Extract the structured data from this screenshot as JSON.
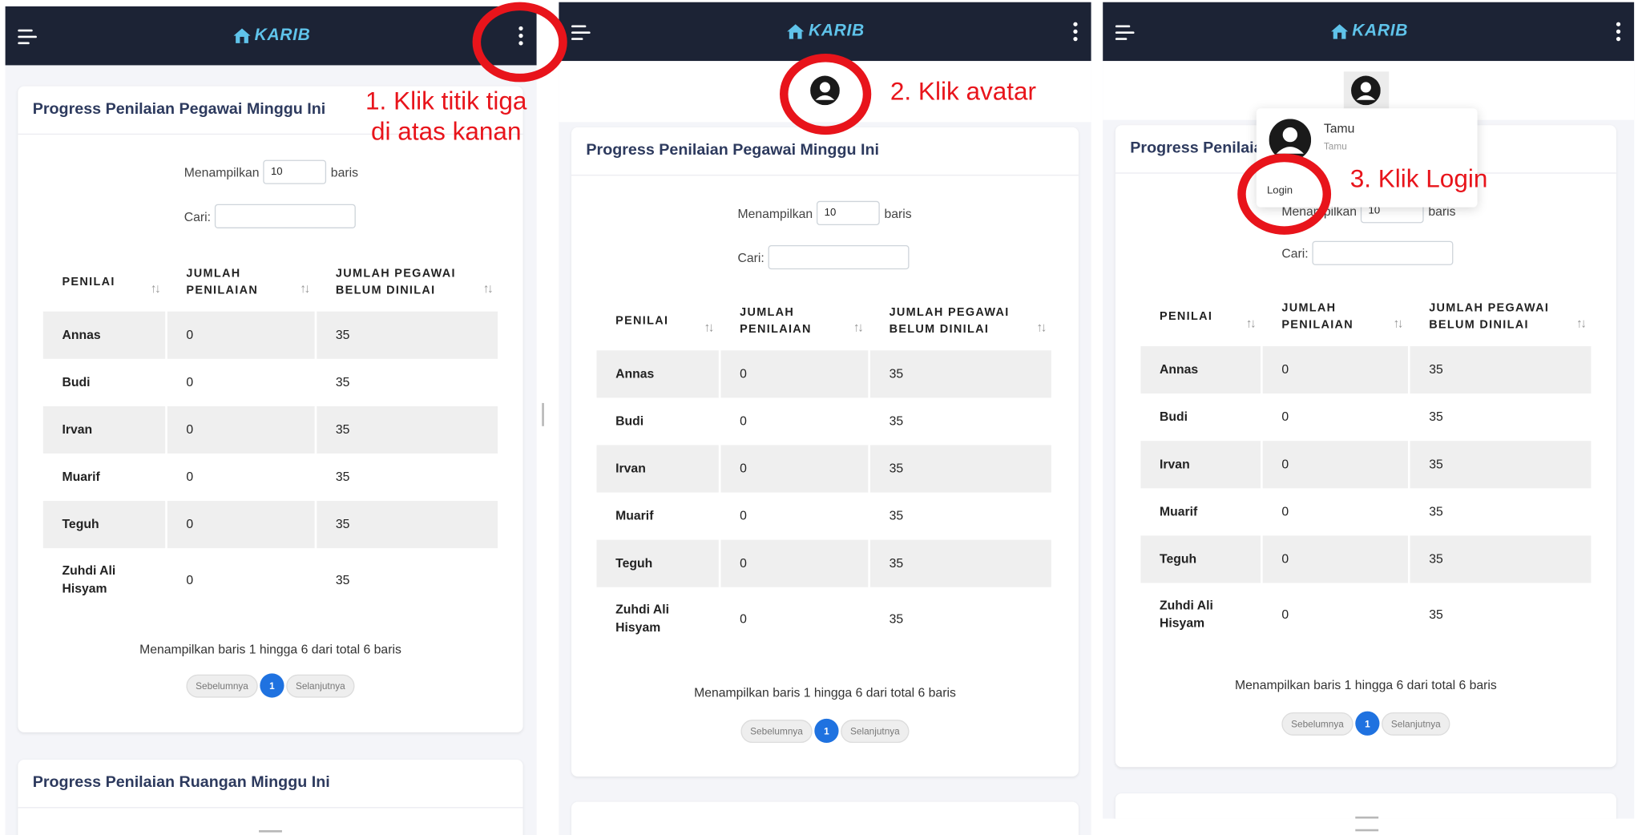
{
  "app": {
    "brand": "KARIB"
  },
  "icons": {
    "menu": "hamburger-menu-icon",
    "more": "kebab-menu-icon",
    "avatar": "user-avatar-icon",
    "sort": "sort-arrows-icon"
  },
  "colors": {
    "topbar": "#1c2335",
    "brand": "#5fc3ea",
    "accent": "#1f72e0",
    "annotation": "#e8141b"
  },
  "annotations": {
    "step1_line1": "1. Klik titik tiga",
    "step1_line2": "di atas kanan",
    "step2": "2. Klik avatar",
    "step3": "3. Klik Login"
  },
  "card": {
    "title": "Progress Penilaian Pegawai Minggu Ini",
    "show_label": "Menampilkan",
    "show_value": "10",
    "show_suffix": "baris",
    "search_label": "Cari:",
    "columns": [
      {
        "line1": "PENILAI",
        "line2": ""
      },
      {
        "line1": "JUMLAH",
        "line2": "PENILAIAN"
      },
      {
        "line1": "JUMLAH PEGAWAI",
        "line2": "BELUM DINILAI"
      }
    ],
    "rows": [
      {
        "name": "Annas",
        "jumlah": "0",
        "belum": "35"
      },
      {
        "name": "Budi",
        "jumlah": "0",
        "belum": "35"
      },
      {
        "name": "Irvan",
        "jumlah": "0",
        "belum": "35"
      },
      {
        "name": "Muarif",
        "jumlah": "0",
        "belum": "35"
      },
      {
        "name": "Teguh",
        "jumlah": "0",
        "belum": "35"
      },
      {
        "name": "Zuhdi Ali Hisyam",
        "jumlah": "0",
        "belum": "35"
      }
    ],
    "info": "Menampilkan baris 1 hingga 6 dari total 6 baris",
    "prev": "Sebelumnya",
    "page": "1",
    "next": "Selanjutnya"
  },
  "card2": {
    "title": "Progress Penilaian Ruangan Minggu Ini"
  },
  "dropdown": {
    "user_name": "Tamu",
    "user_role": "Tamu",
    "login": "Login"
  }
}
